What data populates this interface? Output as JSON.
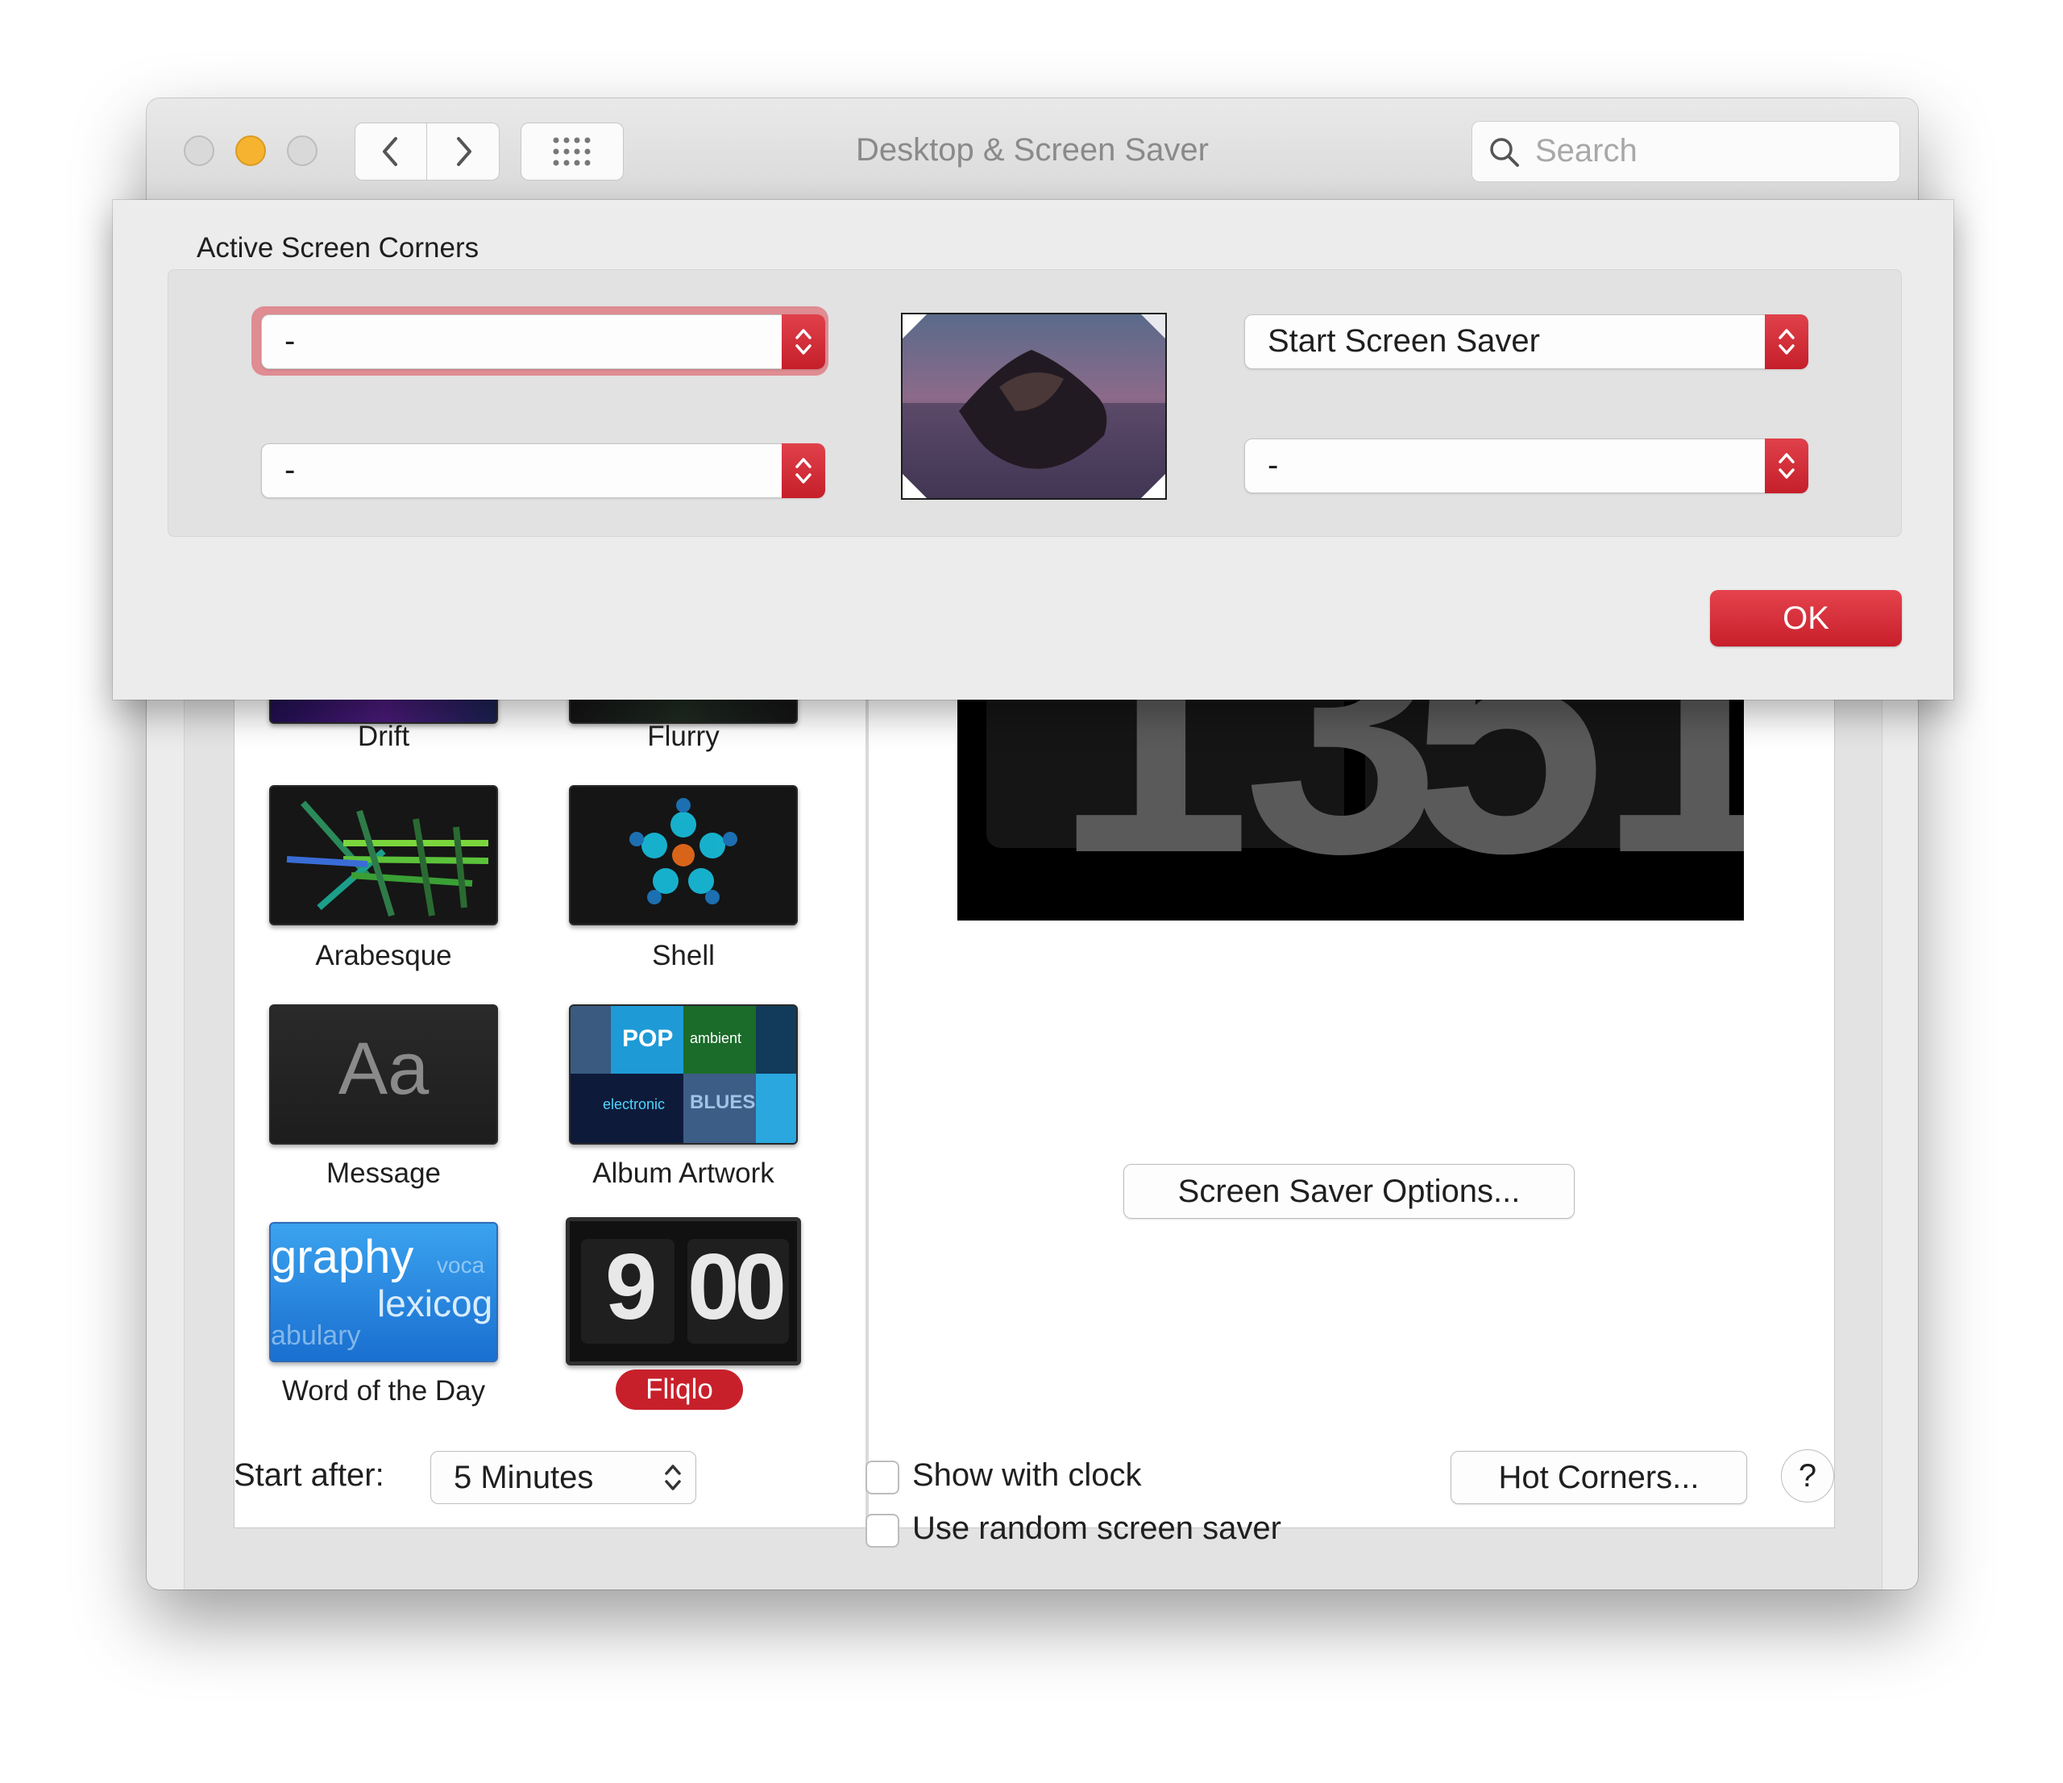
{
  "window": {
    "title": "Desktop & Screen Saver",
    "search_placeholder": "Search"
  },
  "screen_savers": [
    {
      "label": "Drift"
    },
    {
      "label": "Flurry"
    },
    {
      "label": "Arabesque"
    },
    {
      "label": "Shell"
    },
    {
      "label": "Message",
      "thumb_text": "Aa"
    },
    {
      "label": "Album Artwork",
      "thumb_text": [
        "BLUES",
        "POP",
        "ambient",
        "electronic"
      ]
    },
    {
      "label": "Word of the Day",
      "thumb_text": [
        "graphy",
        "voca",
        "lexicog",
        "abulary"
      ]
    },
    {
      "label": "Fliqlo",
      "selected": true,
      "thumb_text": {
        "hour": "9",
        "minute": "00"
      }
    }
  ],
  "preview": {
    "clock_digits": [
      "13",
      "51"
    ]
  },
  "options_button": "Screen Saver Options...",
  "start_after": {
    "label": "Start after:",
    "value": "5 Minutes"
  },
  "show_with_clock": {
    "label": "Show with clock",
    "checked": false
  },
  "random_saver": {
    "label": "Use random screen saver",
    "checked": false
  },
  "hot_corners_button": "Hot Corners...",
  "help_button": "?",
  "sheet": {
    "title": "Active Screen Corners",
    "top_left": "-",
    "bottom_left": "-",
    "top_right": "Start Screen Saver",
    "bottom_right": "-",
    "ok_label": "OK"
  },
  "colors": {
    "accent": "#c8202b",
    "minimize": "#f5b32f",
    "window_bg": "#ececec"
  }
}
